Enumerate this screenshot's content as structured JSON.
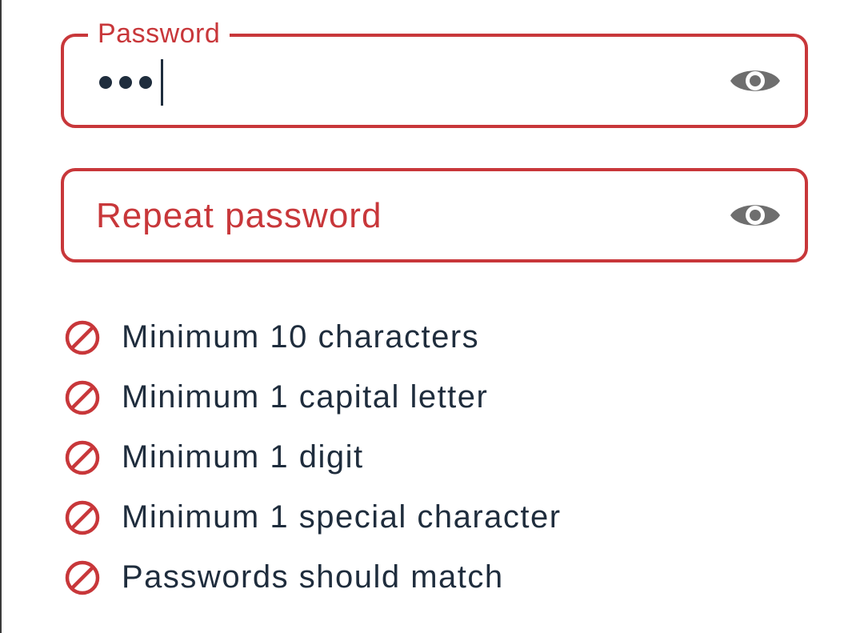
{
  "colors": {
    "error": "#c8373a",
    "text": "#1f2d3d",
    "icon_gray": "#6e6e6e"
  },
  "password_field": {
    "label": "Password",
    "masked_length": 3,
    "focused": true,
    "toggle_icon": "eye-icon"
  },
  "repeat_field": {
    "placeholder": "Repeat password",
    "toggle_icon": "eye-icon"
  },
  "requirements": [
    {
      "label": "Minimum 10 characters",
      "icon": "prohibited-icon",
      "met": false
    },
    {
      "label": "Minimum 1 capital letter",
      "icon": "prohibited-icon",
      "met": false
    },
    {
      "label": "Minimum 1 digit",
      "icon": "prohibited-icon",
      "met": false
    },
    {
      "label": "Minimum 1 special character",
      "icon": "prohibited-icon",
      "met": false
    },
    {
      "label": "Passwords should match",
      "icon": "prohibited-icon",
      "met": false
    }
  ]
}
